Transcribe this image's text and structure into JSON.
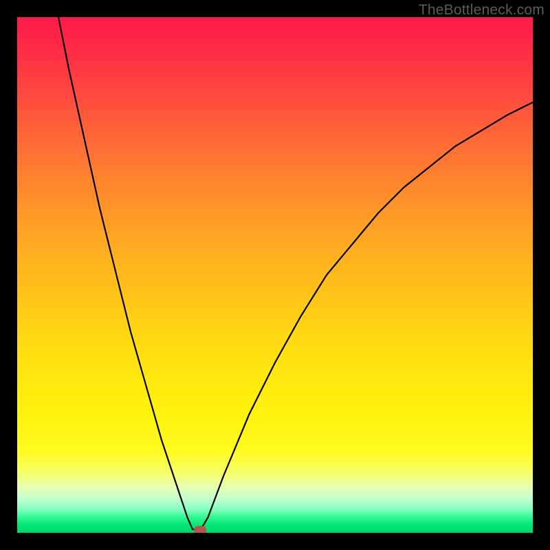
{
  "watermark": "TheBottleneck.com",
  "chart_data": {
    "type": "line",
    "title": "",
    "xlabel": "",
    "ylabel": "",
    "xlim": [
      0,
      100
    ],
    "ylim": [
      0,
      100
    ],
    "grid": false,
    "series": [
      {
        "name": "curve",
        "x": [
          8,
          10,
          12,
          14,
          16,
          18,
          20,
          22,
          24,
          26,
          28,
          30,
          32,
          33,
          34,
          35.5,
          37,
          40,
          45,
          50,
          55,
          60,
          65,
          70,
          75,
          80,
          85,
          90,
          95,
          100
        ],
        "values": [
          100,
          90,
          81,
          72,
          63,
          55,
          47,
          39,
          32,
          25,
          18,
          12,
          6,
          3,
          0.7,
          0.5,
          3,
          11,
          23,
          33,
          42,
          50,
          56,
          62,
          67,
          71,
          75,
          78,
          81,
          83.5
        ]
      }
    ],
    "marker": {
      "x": 35.5,
      "y": 0.5
    },
    "gradient_stops": [
      {
        "pos": 0,
        "color": "#ff1a4a"
      },
      {
        "pos": 0.3,
        "color": "#ff7f30"
      },
      {
        "pos": 0.62,
        "color": "#ffd812"
      },
      {
        "pos": 0.84,
        "color": "#fffb20"
      },
      {
        "pos": 0.95,
        "color": "#80ffc0"
      },
      {
        "pos": 1.0,
        "color": "#00d666"
      }
    ]
  }
}
